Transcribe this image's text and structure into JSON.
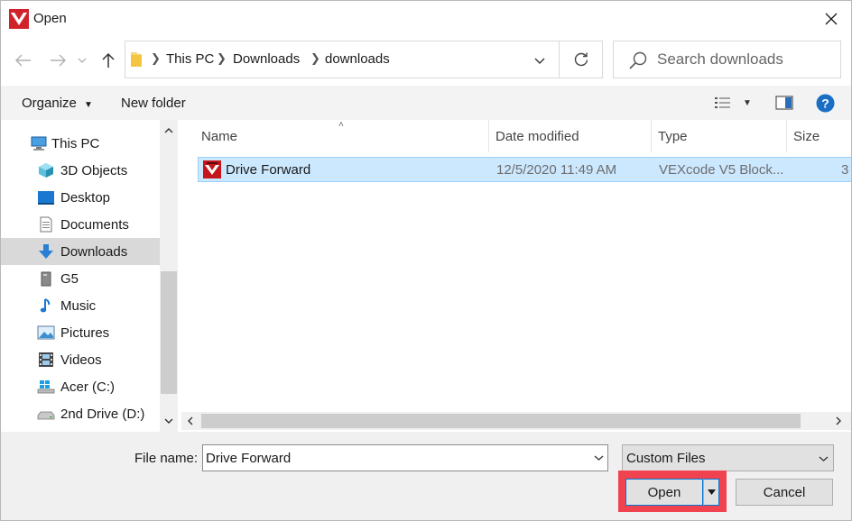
{
  "window": {
    "title": "Open"
  },
  "address": {
    "crumbs": [
      "This PC",
      "Downloads",
      "downloads"
    ]
  },
  "search": {
    "placeholder": "Search downloads"
  },
  "toolbar": {
    "organize": "Organize",
    "new_folder": "New folder"
  },
  "nav": {
    "items": [
      {
        "label": "This PC",
        "icon": "computer-icon"
      },
      {
        "label": "3D Objects",
        "icon": "cube-icon"
      },
      {
        "label": "Desktop",
        "icon": "desktop-icon"
      },
      {
        "label": "Documents",
        "icon": "document-icon"
      },
      {
        "label": "Downloads",
        "icon": "download-arrow-icon",
        "selected": true
      },
      {
        "label": "G5",
        "icon": "drive-icon"
      },
      {
        "label": "Music",
        "icon": "music-note-icon"
      },
      {
        "label": "Pictures",
        "icon": "picture-icon"
      },
      {
        "label": "Videos",
        "icon": "film-icon"
      },
      {
        "label": "Acer (C:)",
        "icon": "windows-drive-icon"
      },
      {
        "label": "2nd Drive (D:)",
        "icon": "drive-icon"
      }
    ]
  },
  "columns": {
    "name": "Name",
    "date": "Date modified",
    "type": "Type",
    "size": "Size"
  },
  "files": [
    {
      "name": "Drive Forward",
      "date": "12/5/2020 11:49 AM",
      "type": "VEXcode V5 Block...",
      "size": "3"
    }
  ],
  "bottom": {
    "filename_label": "File name:",
    "filename_value": "Drive Forward",
    "filetype": "Custom Files",
    "open": "Open",
    "cancel": "Cancel"
  },
  "colors": {
    "accent": "#0078d7",
    "highlight": "#f0424f",
    "selection": "#cce8ff",
    "vex_red": "#d1222b"
  }
}
